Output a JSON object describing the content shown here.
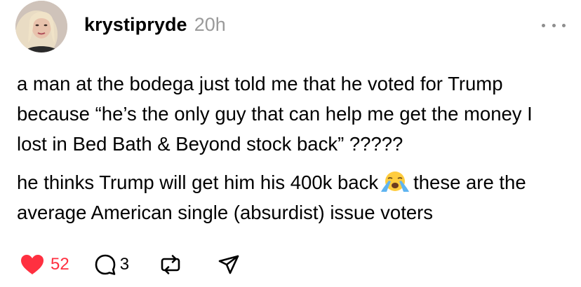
{
  "post": {
    "author": {
      "username": "krystipryde",
      "timestamp": "20h",
      "avatar_icon": "profile-photo"
    },
    "text": {
      "paragraph1": "a man at the bodega just told me that he voted for Trump because “he’s the only guy that can help me get the money I lost in Bed Bath & Beyond stock back” ?????",
      "paragraph2_before": "he thinks Trump will get him his 400k back",
      "paragraph2_emoji": "loudly-crying-face-emoji",
      "paragraph2_after": "these are the average American single (absurdist) issue voters"
    },
    "actions": {
      "like_icon": "heart-icon",
      "like_count": "52",
      "liked": true,
      "reply_icon": "comment-icon",
      "reply_count": "3",
      "repost_icon": "repost-icon",
      "share_icon": "share-icon",
      "more_icon": "more-options-icon"
    },
    "colors": {
      "like_red": "#ff3040",
      "timestamp_gray": "#9a9a9a",
      "icon_gray": "#8e8e8e"
    }
  }
}
